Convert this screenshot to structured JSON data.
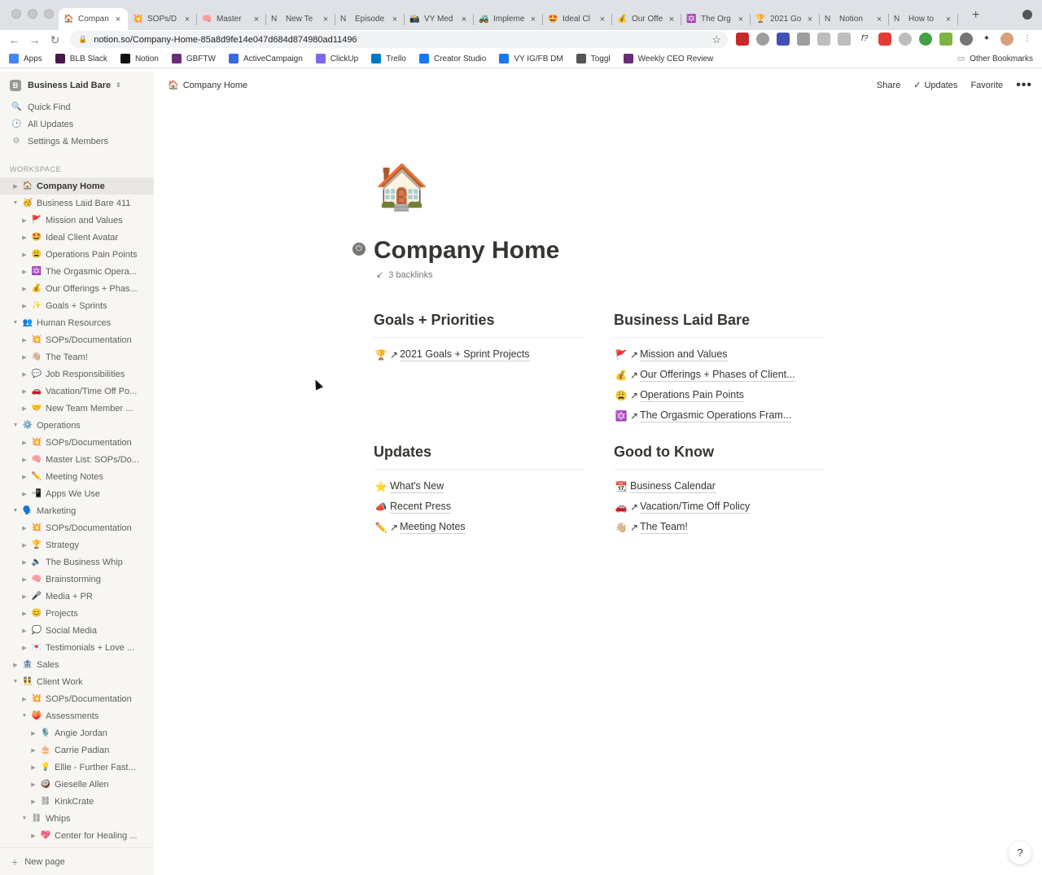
{
  "browser": {
    "tabs": [
      {
        "icon": "🏠",
        "label": "Compan",
        "active": true
      },
      {
        "icon": "💥",
        "label": "SOPs/D"
      },
      {
        "icon": "🧠",
        "label": "Master"
      },
      {
        "icon": "N",
        "label": "New Te"
      },
      {
        "icon": "N",
        "label": "Episode"
      },
      {
        "icon": "📸",
        "label": "VY Med"
      },
      {
        "icon": "🚜",
        "label": "Impleme"
      },
      {
        "icon": "🤩",
        "label": "Ideal Cl"
      },
      {
        "icon": "💰",
        "label": "Our Offe"
      },
      {
        "icon": "🔯",
        "label": "The Org"
      },
      {
        "icon": "🏆",
        "label": "2021 Go"
      },
      {
        "icon": "N",
        "label": "Notion"
      },
      {
        "icon": "N",
        "label": "How to"
      }
    ],
    "url": "notion.so/Company-Home-85a8d9fe14e047d684d874980ad11496",
    "bookmarks": [
      {
        "label": "Apps",
        "color": "#4285f4"
      },
      {
        "label": "BLB Slack",
        "color": "#4a154b"
      },
      {
        "label": "Notion",
        "color": "#111111"
      },
      {
        "label": "GBFTW",
        "color": "#6b2d7a"
      },
      {
        "label": "ActiveCampaign",
        "color": "#356ae6"
      },
      {
        "label": "ClickUp",
        "color": "#7b68ee"
      },
      {
        "label": "Trello",
        "color": "#0079bf"
      },
      {
        "label": "Creator Studio",
        "color": "#1877f2"
      },
      {
        "label": "VY IG/FB DM",
        "color": "#1877f2"
      },
      {
        "label": "Toggl",
        "color": "#555555"
      },
      {
        "label": "Weekly CEO Review",
        "color": "#6b2d7a"
      }
    ],
    "other_bookmarks": "Other Bookmarks"
  },
  "sidebar": {
    "workspace_avatar": "B",
    "workspace_name": "Business Laid Bare",
    "links": [
      {
        "icon": "🔍",
        "label": "Quick Find"
      },
      {
        "icon": "🕒",
        "label": "All Updates"
      },
      {
        "icon": "⚙",
        "label": "Settings & Members"
      }
    ],
    "section_label": "WORKSPACE",
    "tree": [
      {
        "level": 0,
        "open": false,
        "emoji": "🏠",
        "label": "Company Home",
        "active": true
      },
      {
        "level": 0,
        "open": true,
        "emoji": "🥳",
        "label": "Business Laid Bare 411"
      },
      {
        "level": 1,
        "open": false,
        "emoji": "🚩",
        "label": "Mission and Values"
      },
      {
        "level": 1,
        "open": false,
        "emoji": "🤩",
        "label": "Ideal Client Avatar"
      },
      {
        "level": 1,
        "open": false,
        "emoji": "😩",
        "label": "Operations Pain Points"
      },
      {
        "level": 1,
        "open": false,
        "emoji": "🔯",
        "label": "The Orgasmic Opera..."
      },
      {
        "level": 1,
        "open": false,
        "emoji": "💰",
        "label": "Our Offerings + Phas..."
      },
      {
        "level": 1,
        "open": false,
        "emoji": "✨",
        "label": "Goals + Sprints"
      },
      {
        "level": 0,
        "open": true,
        "emoji": "👥",
        "label": "Human Resources"
      },
      {
        "level": 1,
        "open": false,
        "emoji": "💥",
        "label": "SOPs/Documentation"
      },
      {
        "level": 1,
        "open": false,
        "emoji": "👋🏼",
        "label": "The Team!"
      },
      {
        "level": 1,
        "open": false,
        "emoji": "💬",
        "label": "Job Responsibilities"
      },
      {
        "level": 1,
        "open": false,
        "emoji": "🚗",
        "label": "Vacation/Time Off Po..."
      },
      {
        "level": 1,
        "open": false,
        "emoji": "🤝",
        "label": "New Team Member ..."
      },
      {
        "level": 0,
        "open": true,
        "emoji": "⚙️",
        "label": "Operations"
      },
      {
        "level": 1,
        "open": false,
        "emoji": "💥",
        "label": "SOPs/Documentation"
      },
      {
        "level": 1,
        "open": false,
        "emoji": "🧠",
        "label": "Master List: SOPs/Do..."
      },
      {
        "level": 1,
        "open": false,
        "emoji": "✏️",
        "label": "Meeting Notes"
      },
      {
        "level": 1,
        "open": false,
        "emoji": "📲",
        "label": "Apps We Use"
      },
      {
        "level": 0,
        "open": true,
        "emoji": "🗣️",
        "label": "Marketing"
      },
      {
        "level": 1,
        "open": false,
        "emoji": "💥",
        "label": "SOPs/Documentation"
      },
      {
        "level": 1,
        "open": false,
        "emoji": "🏆",
        "label": "Strategy"
      },
      {
        "level": 1,
        "open": false,
        "emoji": "🔈",
        "label": "The Business Whip"
      },
      {
        "level": 1,
        "open": false,
        "emoji": "🧠",
        "label": "Brainstorming"
      },
      {
        "level": 1,
        "open": false,
        "emoji": "🎤",
        "label": "Media + PR"
      },
      {
        "level": 1,
        "open": false,
        "emoji": "😊",
        "label": "Projects"
      },
      {
        "level": 1,
        "open": false,
        "emoji": "💭",
        "label": "Social Media"
      },
      {
        "level": 1,
        "open": false,
        "emoji": "💌",
        "label": "Testimonials + Love ..."
      },
      {
        "level": 0,
        "open": false,
        "emoji": "🏦",
        "label": "Sales"
      },
      {
        "level": 0,
        "open": true,
        "emoji": "👯",
        "label": "Client Work"
      },
      {
        "level": 1,
        "open": false,
        "emoji": "💥",
        "label": "SOPs/Documentation"
      },
      {
        "level": 1,
        "open": true,
        "emoji": "🍑",
        "label": "Assessments"
      },
      {
        "level": 2,
        "open": false,
        "emoji": "🎙️",
        "label": "Angie Jordan"
      },
      {
        "level": 2,
        "open": false,
        "emoji": "🎂",
        "label": "Carrie Padian"
      },
      {
        "level": 2,
        "open": false,
        "emoji": "💡",
        "label": "Ellie - Further Fast..."
      },
      {
        "level": 2,
        "open": false,
        "emoji": "🥥",
        "label": "Gieselle Allen"
      },
      {
        "level": 2,
        "open": false,
        "emoji": "⛓",
        "label": "KinkCrate"
      },
      {
        "level": 1,
        "open": true,
        "emoji": "⛓",
        "label": "Whips"
      },
      {
        "level": 2,
        "open": false,
        "emoji": "💖",
        "label": "Center for Healing ..."
      }
    ],
    "new_page": "New page"
  },
  "topbar": {
    "crumb_emoji": "🏠",
    "crumb": "Company Home",
    "share": "Share",
    "updates": "Updates",
    "favorite": "Favorite"
  },
  "page": {
    "icon": "🏠",
    "title": "Company Home",
    "backlinks": "3 backlinks",
    "columns": [
      {
        "heading": "Goals + Priorities",
        "links": [
          {
            "emoji": "🏆",
            "ext": true,
            "label": "2021 Goals + Sprint Projects"
          }
        ]
      },
      {
        "heading": "Business Laid Bare",
        "links": [
          {
            "emoji": "🚩",
            "ext": true,
            "label": "Mission and Values"
          },
          {
            "emoji": "💰",
            "ext": true,
            "label": "Our Offerings + Phases of Client..."
          },
          {
            "emoji": "😩",
            "ext": true,
            "label": "Operations Pain Points"
          },
          {
            "emoji": "🔯",
            "ext": true,
            "label": "The Orgasmic Operations Fram..."
          }
        ]
      },
      {
        "heading": "Updates",
        "links": [
          {
            "emoji": "⭐",
            "ext": false,
            "label": "What's New"
          },
          {
            "emoji": "📣",
            "ext": false,
            "label": "Recent Press"
          },
          {
            "emoji": "✏️",
            "ext": true,
            "label": "Meeting Notes"
          }
        ]
      },
      {
        "heading": "Good to Know",
        "links": [
          {
            "emoji": "📆",
            "ext": false,
            "label": "Business Calendar"
          },
          {
            "emoji": "🚗",
            "ext": true,
            "label": "Vacation/Time Off Policy"
          },
          {
            "emoji": "👋🏼",
            "ext": true,
            "label": "The Team!"
          }
        ]
      }
    ]
  },
  "help": "?"
}
